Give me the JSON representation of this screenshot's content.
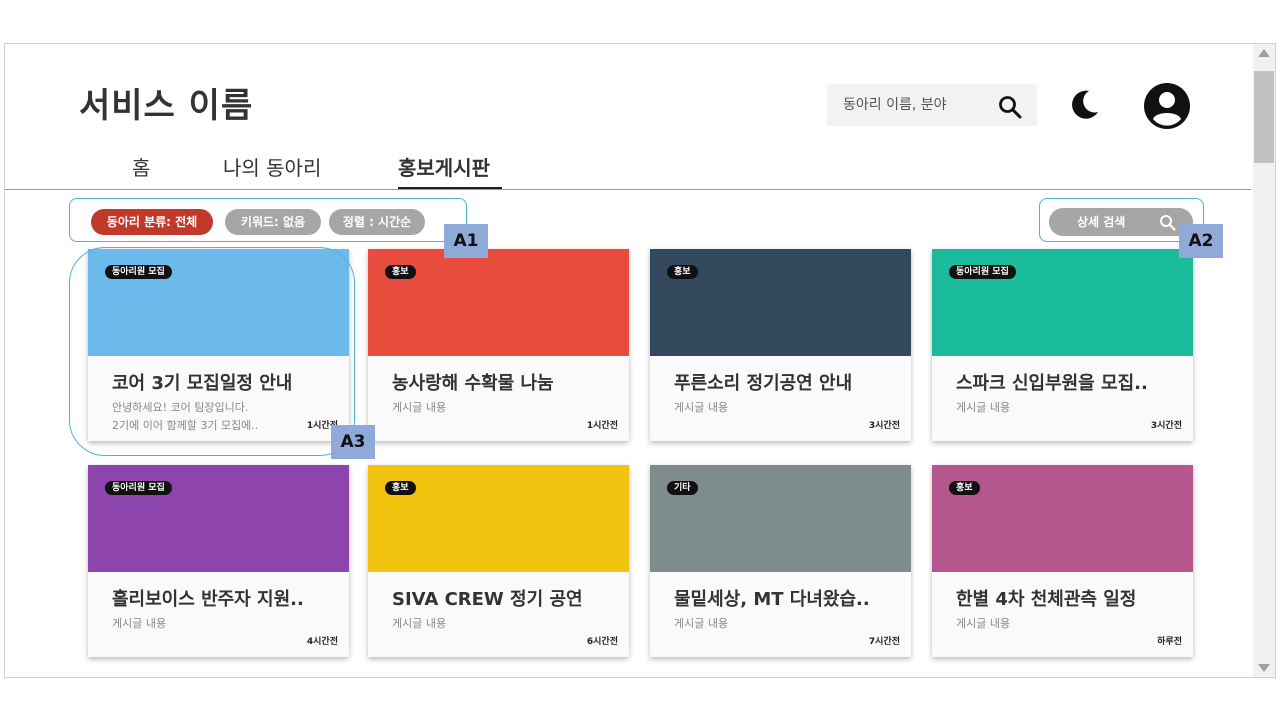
{
  "header": {
    "title": "서비스 이름",
    "search_placeholder": "동아리 이름, 분야"
  },
  "tabs": [
    {
      "label": "홈"
    },
    {
      "label": "나의 동아리"
    },
    {
      "label": "홍보게시판"
    }
  ],
  "filters": {
    "chips": [
      {
        "label": "동아리 분류: 전체",
        "color": "#c0392b"
      },
      {
        "label": "키워드: 없음",
        "color": "#a6a6a6"
      },
      {
        "label": "정렬 : 시간순",
        "color": "#a6a6a6"
      }
    ],
    "detail_search_label": "상세 검색"
  },
  "annotations": [
    "A1",
    "A2",
    "A3"
  ],
  "cards": [
    {
      "badge": "동아리원 모집",
      "color": "#6cb9ec",
      "title": "코어 3기 모집일정 안내",
      "body": [
        "안녕하세요! 코어 팀장입니다.",
        "2기에 이어 함께할 3기 모집에.."
      ],
      "time": "1시간전"
    },
    {
      "badge": "홍보",
      "color": "#e74c3c",
      "title": "농사랑해 수확물 나눔",
      "body": [
        "게시글 내용"
      ],
      "time": "1시간전"
    },
    {
      "badge": "홍보",
      "color": "#34495e",
      "title": "푸른소리 정기공연 안내",
      "body": [
        "게시글 내용"
      ],
      "time": "3시간전"
    },
    {
      "badge": "동아리원 모집",
      "color": "#1abc9c",
      "title": "스파크 신입부원을 모집..",
      "body": [
        "게시글 내용"
      ],
      "time": "3시간전"
    },
    {
      "badge": "동아리원 모집",
      "color": "#8e44ad",
      "title": "홀리보이스 반주자 지원..",
      "body": [
        "게시글 내용"
      ],
      "time": "4시간전"
    },
    {
      "badge": "홍보",
      "color": "#f1c40f",
      "title": "SIVA CREW 정기 공연",
      "body": [
        "게시글 내용"
      ],
      "time": "6시간전"
    },
    {
      "badge": "기타",
      "color": "#7f8c8d",
      "title": "물밑세상, MT 다녀왔습..",
      "body": [
        "게시글 내용"
      ],
      "time": "7시간전"
    },
    {
      "badge": "홍보",
      "color": "#b5568d",
      "title": "한별 4차 천체관측 일정",
      "body": [
        "게시글 내용"
      ],
      "time": "하루전"
    }
  ]
}
